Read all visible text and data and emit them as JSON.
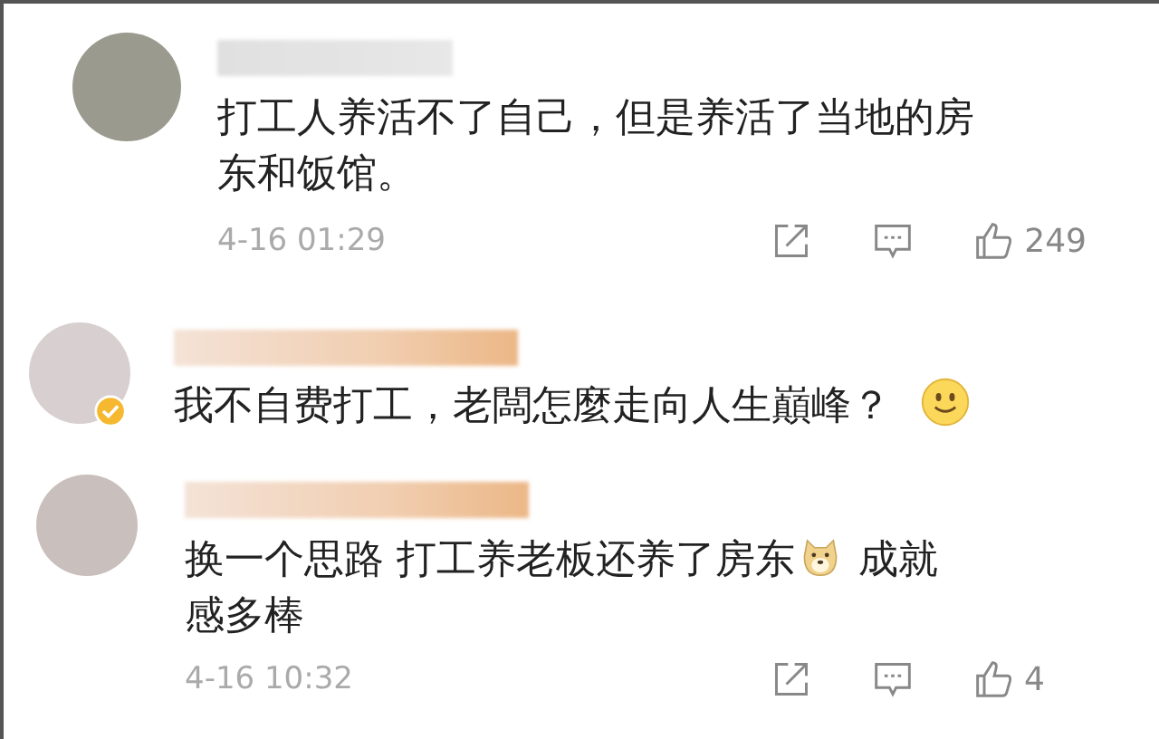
{
  "comments": [
    {
      "verified": false,
      "segments": [
        {
          "kind": "text",
          "text": "打工人养活不了自己，但是养活了当地的房东和饭馆。"
        }
      ],
      "time": "4-16 01:29",
      "likes": "249"
    },
    {
      "verified": true,
      "segments": [
        {
          "kind": "text",
          "text": "我不自费打工，老闆怎麼走向人生巔峰？"
        },
        {
          "kind": "smiley"
        }
      ]
    },
    {
      "verified": false,
      "segments": [
        {
          "kind": "text",
          "text": "换一个思路 打工养老板还养了房东"
        },
        {
          "kind": "dog"
        },
        {
          "kind": "text",
          "text": " 成就感多棒"
        }
      ],
      "time": "4-16 10:32",
      "likes": "4"
    }
  ]
}
